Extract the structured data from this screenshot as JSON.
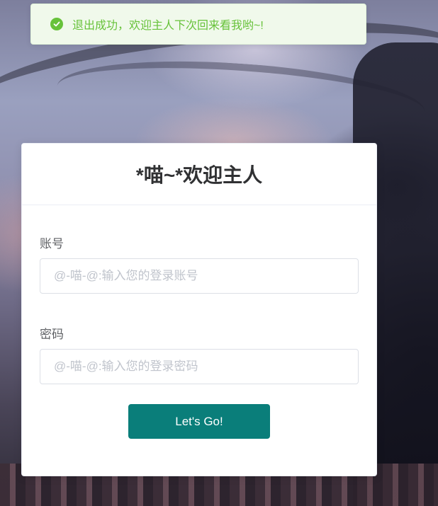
{
  "toast": {
    "message": "退出成功，欢迎主人下次回来看我哟~!",
    "icon": "check-circle-icon",
    "color": "#67c23a"
  },
  "login_card": {
    "title": "*喵~*欢迎主人",
    "username": {
      "label": "账号",
      "value": "",
      "placeholder": "@-喵-@:输入您的登录账号"
    },
    "password": {
      "label": "密码",
      "value": "",
      "placeholder": "@-喵-@:输入您的登录密码"
    },
    "submit_label": "Let's Go!",
    "accent_color": "#0a7e7a"
  }
}
